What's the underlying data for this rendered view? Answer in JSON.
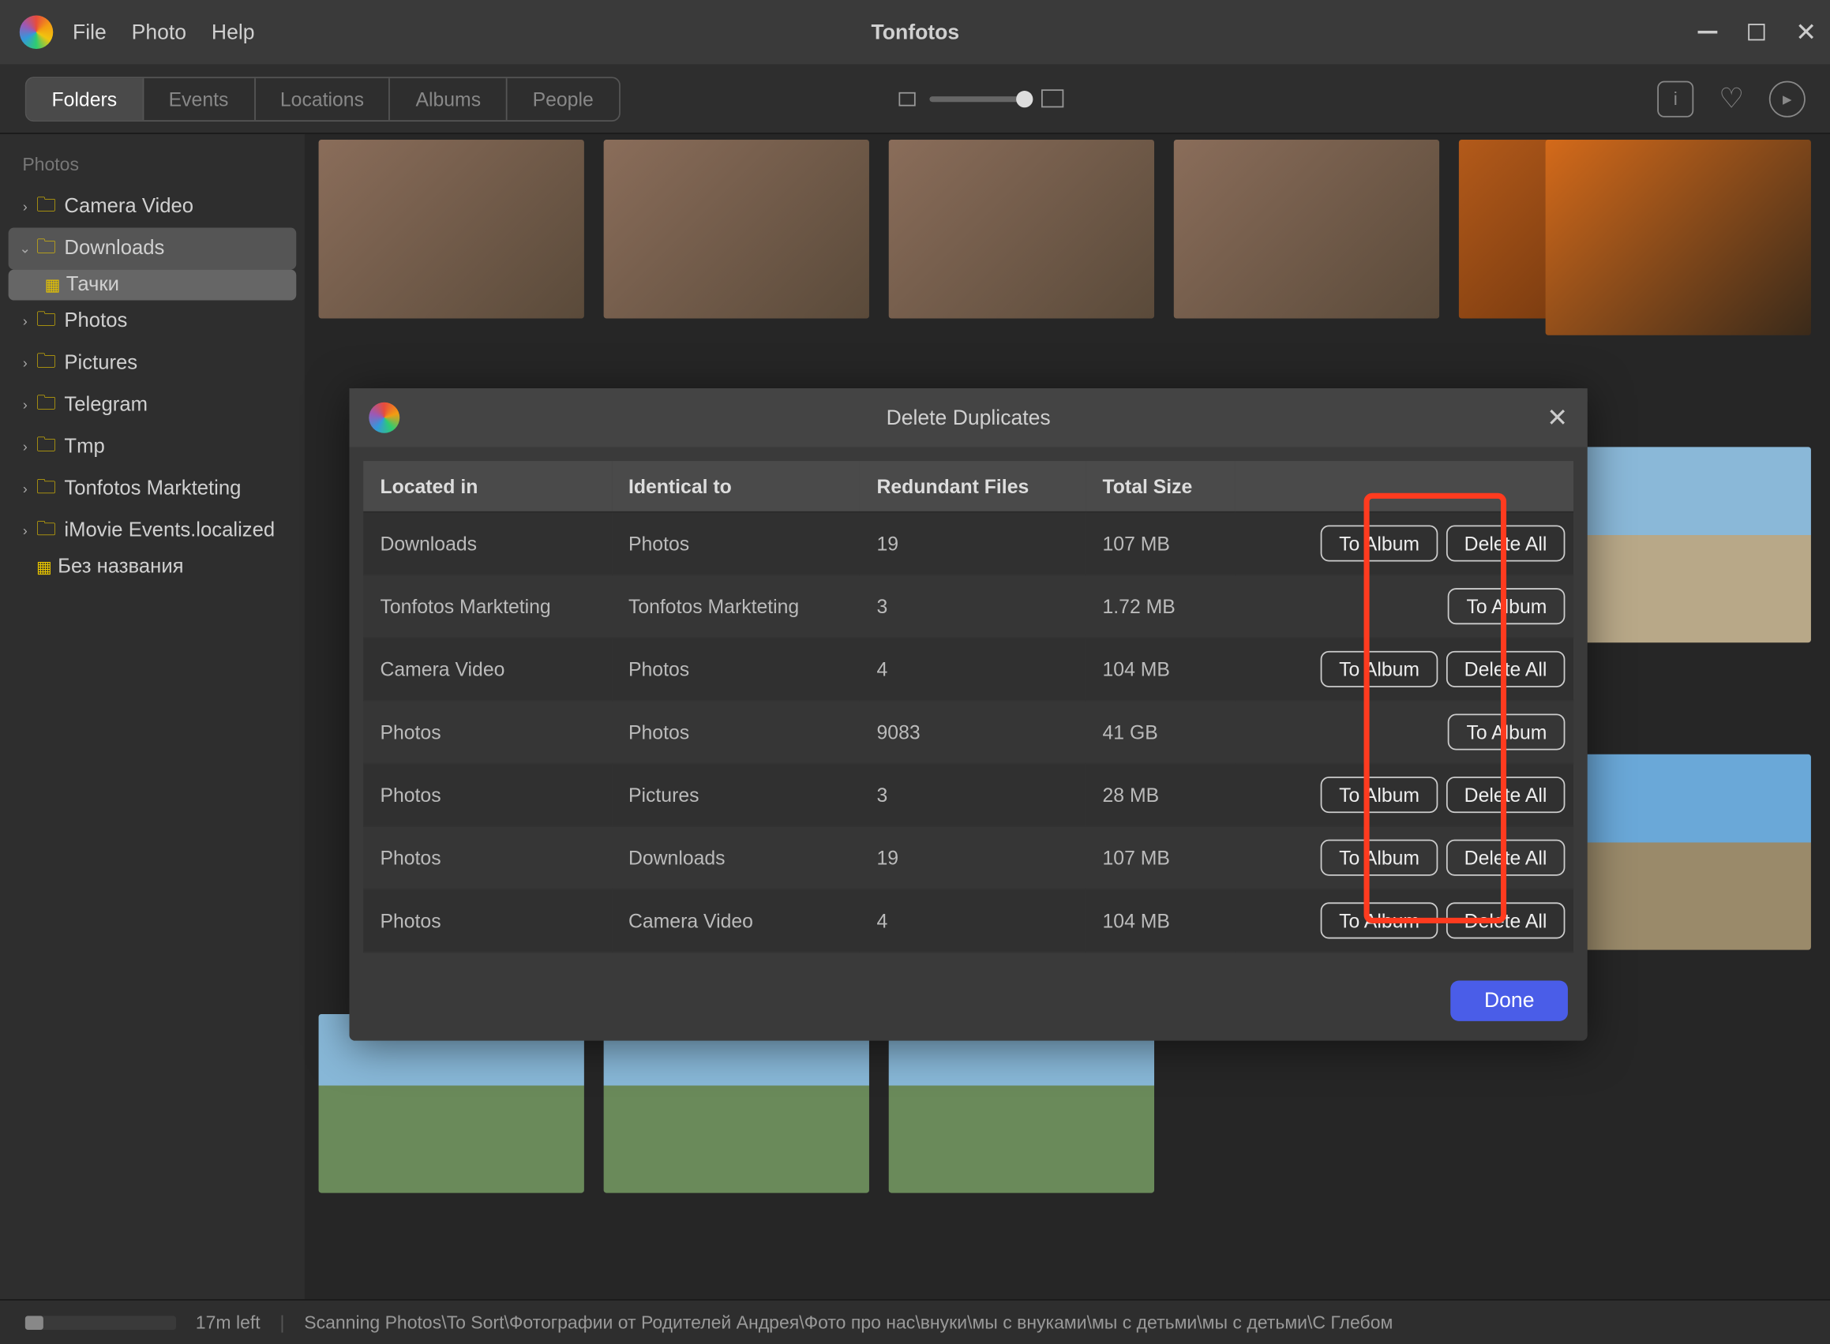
{
  "app": {
    "title": "Tonfotos"
  },
  "menu": {
    "file": "File",
    "photo": "Photo",
    "help": "Help"
  },
  "tabs": {
    "folders": "Folders",
    "events": "Events",
    "locations": "Locations",
    "albums": "Albums",
    "people": "People"
  },
  "sidebar": {
    "header": "Photos",
    "items": [
      {
        "label": "Camera Video"
      },
      {
        "label": "Downloads"
      },
      {
        "label": "Тачки"
      },
      {
        "label": "Photos"
      },
      {
        "label": "Pictures"
      },
      {
        "label": "Telegram"
      },
      {
        "label": "Tmp"
      },
      {
        "label": "Tonfotos Markteting"
      },
      {
        "label": "iMovie Events.localized"
      },
      {
        "label": "Без названия"
      }
    ]
  },
  "modal": {
    "title": "Delete Duplicates",
    "headers": {
      "c1": "Located in",
      "c2": "Identical to",
      "c3": "Redundant Files",
      "c4": "Total Size"
    },
    "button_album": "To Album",
    "button_delete": "Delete All",
    "done": "Done",
    "rows": [
      {
        "loc": "Downloads",
        "ident": "Photos",
        "files": "19",
        "size": "107 MB",
        "del": true
      },
      {
        "loc": "Tonfotos Markteting",
        "ident": "Tonfotos Markteting",
        "files": "3",
        "size": "1.72 MB",
        "del": false
      },
      {
        "loc": "Camera Video",
        "ident": "Photos",
        "files": "4",
        "size": "104 MB",
        "del": true
      },
      {
        "loc": "Photos",
        "ident": "Photos",
        "files": "9083",
        "size": "41 GB",
        "del": false
      },
      {
        "loc": "Photos",
        "ident": "Pictures",
        "files": "3",
        "size": "28 MB",
        "del": true
      },
      {
        "loc": "Photos",
        "ident": "Downloads",
        "files": "19",
        "size": "107 MB",
        "del": true
      },
      {
        "loc": "Photos",
        "ident": "Camera Video",
        "files": "4",
        "size": "104 MB",
        "del": true
      }
    ]
  },
  "status": {
    "time": "17m left",
    "scan": "Scanning Photos\\To Sort\\Фотографии от Родителей Андрея\\Фото про нас\\внуки\\мы с внуками\\мы с детьми\\мы с детьми\\С Глебом"
  }
}
